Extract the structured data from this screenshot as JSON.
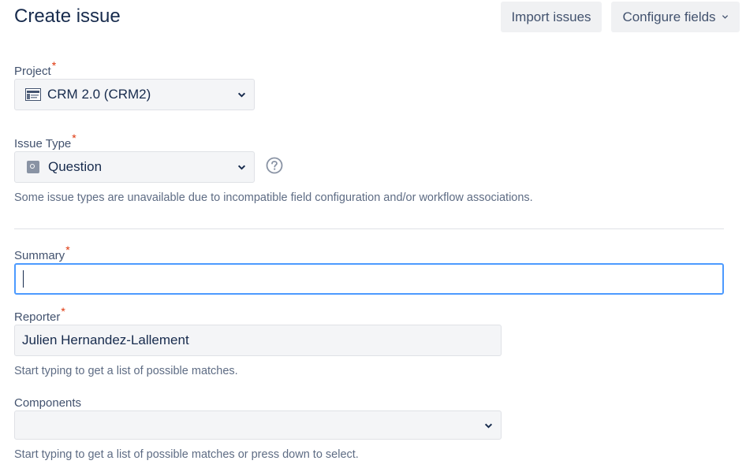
{
  "header": {
    "title": "Create issue",
    "import_label": "Import issues",
    "configure_label": "Configure fields"
  },
  "project": {
    "label": "Project",
    "required_mark": "*",
    "value": "CRM 2.0 (CRM2)",
    "icon": "project-avatar-icon"
  },
  "issue_type": {
    "label": "Issue Type",
    "required_mark": "*",
    "value": "Question",
    "icon": "question-type-icon",
    "hint": "Some issue types are unavailable due to incompatible field configuration and/or workflow associations."
  },
  "summary": {
    "label": "Summary",
    "required_mark": "*",
    "value": ""
  },
  "reporter": {
    "label": "Reporter",
    "required_mark": "*",
    "value": "Julien Hernandez-Lallement",
    "hint": "Start typing to get a list of possible matches."
  },
  "components": {
    "label": "Components",
    "value": "",
    "hint": "Start typing to get a list of possible matches or press down to select."
  },
  "colors": {
    "accent_focus": "#4c9aff",
    "required": "#de350b",
    "text": "#172b4d",
    "field_bg": "#f4f5f7"
  }
}
